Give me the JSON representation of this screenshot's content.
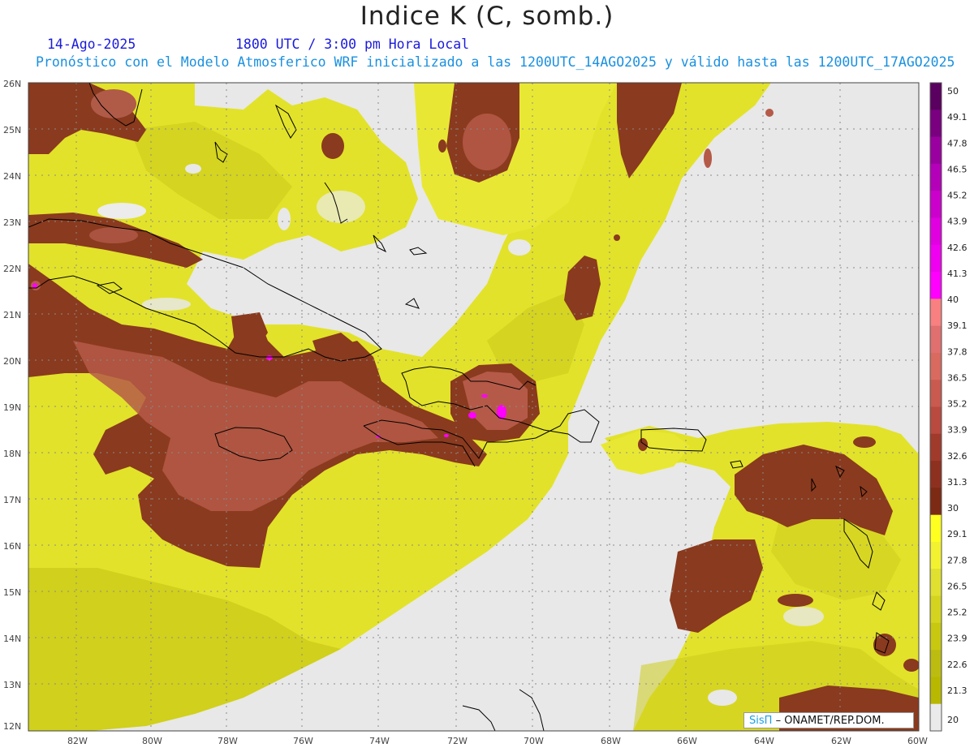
{
  "title": "Indice K (C, somb.)",
  "date_label": "14-Ago-2025",
  "time_label": "1800 UTC / 3:00 pm Hora Local",
  "model_label": "Pronóstico con el Modelo Atmosferico WRF inicializado a las 1200UTC_14AGO2025 y válido hasta las  1200UTC_17AGO2025",
  "credit": {
    "brand": "SisΠ",
    "org": "– ONAMET/REP.DOM."
  },
  "lat_labels": [
    "26N",
    "25N",
    "24N",
    "23N",
    "22N",
    "21N",
    "20N",
    "19N",
    "18N",
    "17N",
    "16N",
    "15N",
    "14N",
    "13N",
    "12N"
  ],
  "lon_labels": [
    "82W",
    "80W",
    "78W",
    "76W",
    "74W",
    "72W",
    "70W",
    "68W",
    "66W",
    "64W",
    "62W",
    "60W"
  ],
  "colorbar": {
    "labels": [
      "50",
      "49.1",
      "47.8",
      "46.5",
      "45.2",
      "43.9",
      "42.6",
      "41.3",
      "40",
      "39.1",
      "37.8",
      "36.5",
      "35.2",
      "33.9",
      "32.6",
      "31.3",
      "30",
      "29.1",
      "27.8",
      "26.5",
      "25.2",
      "23.9",
      "22.6",
      "21.3",
      "20"
    ],
    "colors": [
      "#5a0060",
      "#7a0080",
      "#9a00a0",
      "#b400b8",
      "#cc00cc",
      "#e000e0",
      "#f000f0",
      "#ff00ff",
      "#f88080",
      "#e07070",
      "#d86a60",
      "#c85a50",
      "#b84a40",
      "#a03a2a",
      "#8e3020",
      "#7c2a14",
      "#ffff20",
      "#f2f230",
      "#e0e030",
      "#d4d420",
      "#c8c810",
      "#bcbc10",
      "#b8b800",
      "#eaeaea"
    ]
  },
  "colors": {
    "ocean_low": "#e8e8e8",
    "yellow_main": "#e6e628",
    "yellow_dark": "#c8c814",
    "yellow_light": "#f4f432",
    "brown_dark": "#8a3a1e",
    "brown_mid": "#a8503a",
    "brown_light": "#c06a58",
    "magenta": "#ff00ff"
  }
}
